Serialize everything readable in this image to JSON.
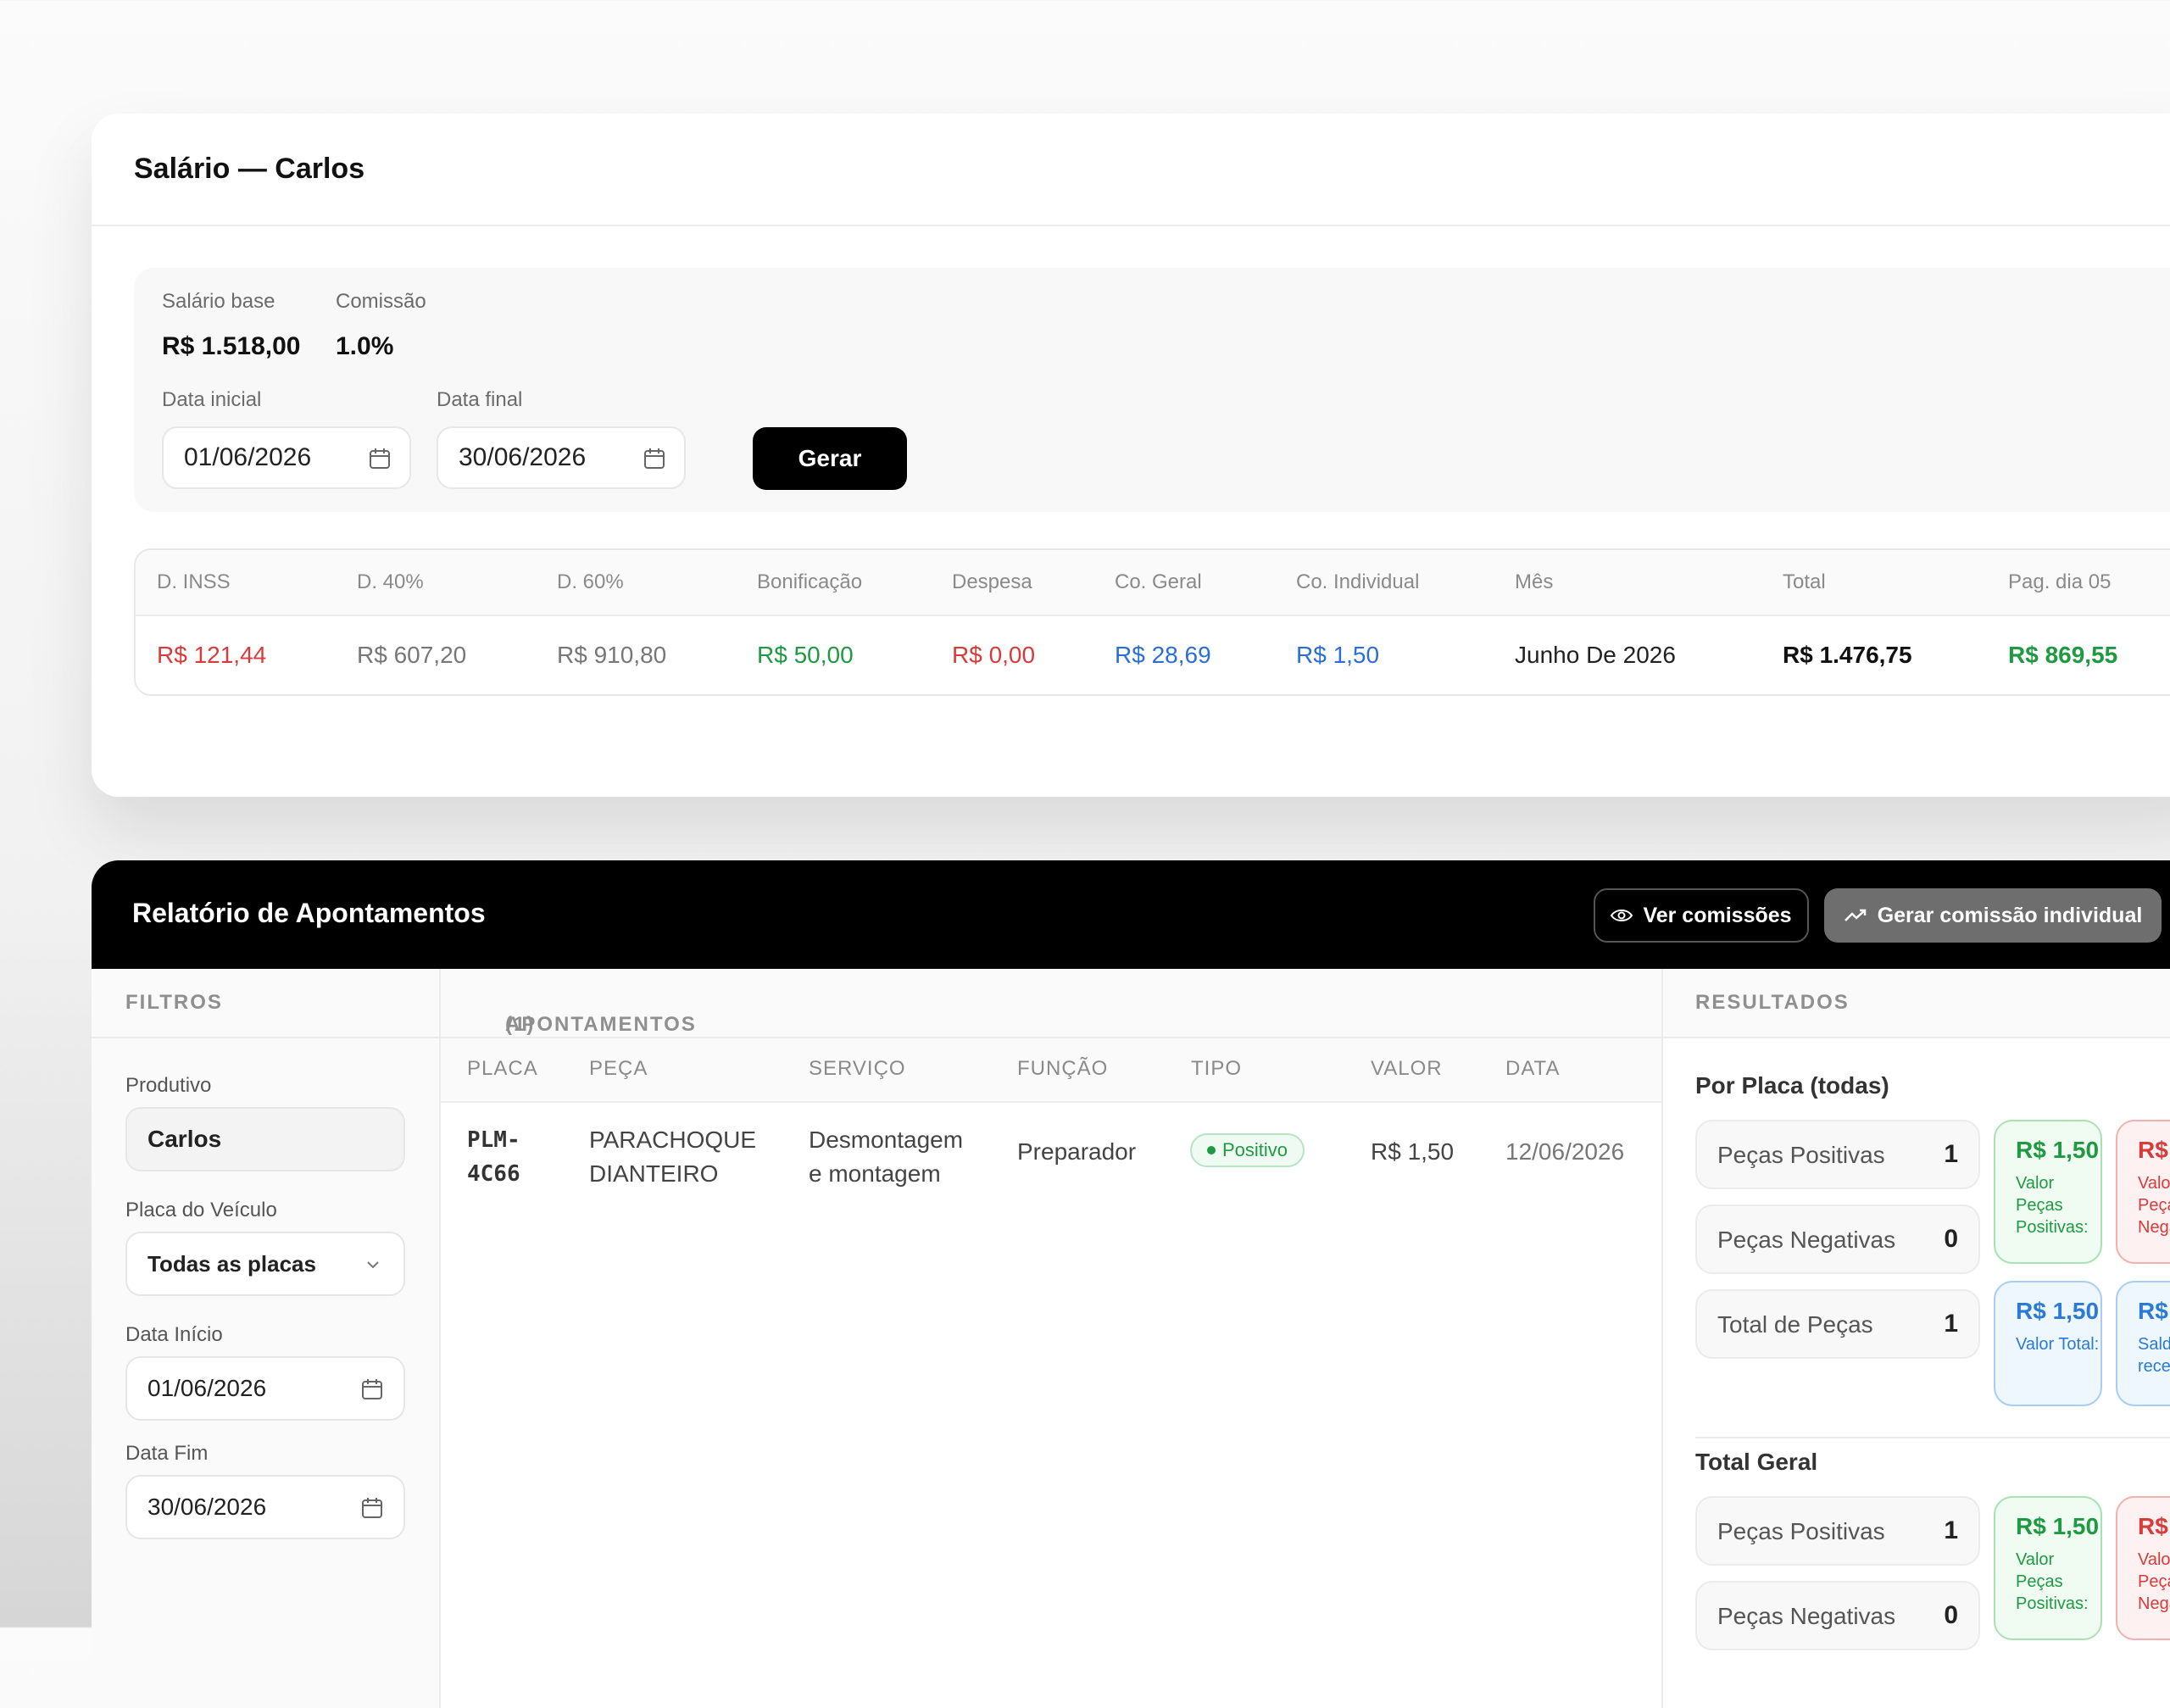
{
  "salary_card": {
    "title": "Salário — Carlos",
    "base_label": "Salário base",
    "base_value": "R$ 1.518,00",
    "commission_label": "Comissão",
    "commission_value": "1.0%",
    "start_label": "Data inicial",
    "start_value": "01/06/2026",
    "end_label": "Data final",
    "end_value": "30/06/2026",
    "generate_label": "Gerar"
  },
  "summary": {
    "headers": [
      "D. INSS",
      "D. 40%",
      "D. 60%",
      "Bonificação",
      "Despesa",
      "Co. Geral",
      "Co. Individual",
      "Mês",
      "Total",
      "Pag. dia 05"
    ],
    "values": [
      "R$ 121,44",
      "R$ 607,20",
      "R$ 910,80",
      "R$ 50,00",
      "R$ 0,00",
      "R$ 28,69",
      "R$ 1,50",
      "Junho De 2026",
      "R$ 1.476,75",
      "R$ 869,55"
    ]
  },
  "report": {
    "title": "Relatório de Apontamentos",
    "view_commissions": "Ver comissões",
    "generate_individual": "Gerar comissão individual"
  },
  "filters": {
    "heading": "FILTROS",
    "productive_label": "Produtivo",
    "productive_value": "Carlos",
    "plate_label": "Placa do Veículo",
    "plate_value": "Todas as placas",
    "start_label": "Data Início",
    "start_value": "01/06/2026",
    "end_label": "Data Fim",
    "end_value": "30/06/2026"
  },
  "appointments": {
    "heading": "APONTAMENTOS",
    "count": "(1)",
    "columns": [
      "PLACA",
      "PEÇA",
      "SERVIÇO",
      "FUNÇÃO",
      "TIPO",
      "VALOR",
      "DATA"
    ],
    "rows": [
      {
        "plate_line1": "PLM-",
        "plate_line2": "4C66",
        "part_line1": "PARACHOQUE",
        "part_line2": "DIANTEIRO",
        "service_line1": "Desmontagem",
        "service_line2": "e montagem",
        "role": "Preparador",
        "type": "Positivo",
        "value": "R$ 1,50",
        "date": "12/06/2026"
      }
    ]
  },
  "results": {
    "heading": "RESULTADOS",
    "by_plate": {
      "title": "Por Placa (todas)",
      "positive_label": "Peças Positivas",
      "positive_count": "1",
      "negative_label": "Peças Negativas",
      "negative_count": "0",
      "total_label": "Total de Peças",
      "total_count": "1",
      "pill_pos_value": "R$ 1,50",
      "pill_pos_label": "Valor Peças Positivas:",
      "pill_neg_value": "R$",
      "pill_neg_label": "Valor Peças Negativas:",
      "pill_total_value": "R$ 1,50",
      "pill_total_label": "Valor Total:",
      "pill_bal_value": "R$",
      "pill_bal_label": "Saldo receber:"
    },
    "overall": {
      "title": "Total Geral",
      "positive_label": "Peças Positivas",
      "positive_count": "1",
      "negative_label": "Peças Negativas",
      "negative_count": "0",
      "pill_pos_value": "R$ 1,50",
      "pill_pos_label": "Valor Peças Positivas:",
      "pill_neg_value": "R$",
      "pill_neg_label": "Valor Peças Negativas:"
    }
  },
  "colors": {
    "red": "#d93b3b",
    "gray": "#6b6b6b",
    "green": "#1e9a42",
    "blue": "#2b6fd6",
    "dark": "#111111"
  }
}
